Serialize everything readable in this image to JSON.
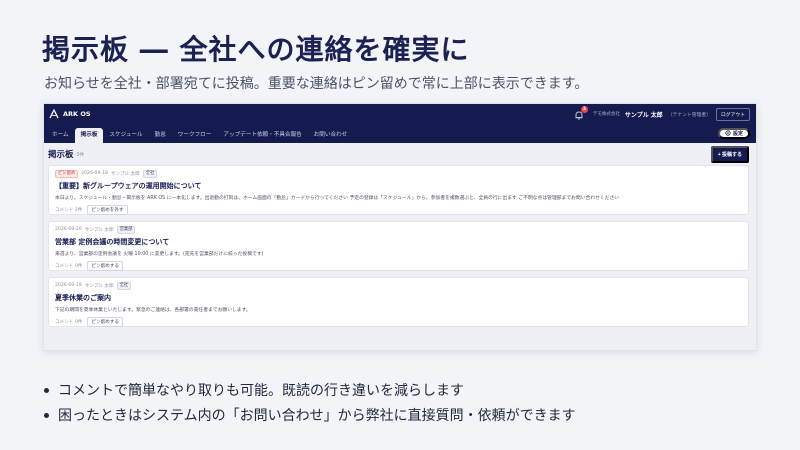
{
  "slide": {
    "title": "掲示板 ― 全社への連絡を確実に",
    "subtitle": "お知らせを全社・部署宛てに投稿。重要な連絡はピン留めで常に上部に表示できます。",
    "bullets": [
      "コメントで簡単なやり取りも可能。既読の行き違いを減らします",
      "困ったときはシステム内の「お問い合わせ」から弊社に直接質問・依頼ができます"
    ]
  },
  "app": {
    "logo_text": "ARK OS",
    "notification_count": "3",
    "company": "デモ株式会社",
    "user_name": "サンプル 太郎",
    "user_role": "（テナント管理者）",
    "logout_label": "ログアウト",
    "nav_tabs": [
      {
        "label": "ホーム",
        "active": false
      },
      {
        "label": "掲示板",
        "active": true
      },
      {
        "label": "スケジュール",
        "active": false
      },
      {
        "label": "勤怠",
        "active": false
      },
      {
        "label": "ワークフロー",
        "active": false
      },
      {
        "label": "アップデート依頼・不具合報告",
        "active": false
      },
      {
        "label": "お問い合わせ",
        "active": false
      }
    ],
    "settings_label": "設定",
    "board": {
      "title": "掲示板",
      "count": "3件",
      "post_button_label": "+ 投稿する"
    },
    "posts": [
      {
        "pin_label": "ピン留め",
        "date": "2026-09-18",
        "author": "サンプル 太郎",
        "audience": "全社",
        "title": "【重要】新グループウェアの運用開始について",
        "body": "本日より、スケジュール・勤怠・掲示板を ARK OS に一本化します。出退勤の打刻は、ホーム画面の「勤怠」カードから行ってください 予定の登録は「スケジュール」から。参加者を複数選ぶと、全員の行に出ます ご不明な点は管理部までお問い合わせください",
        "comments": "コメント 2件",
        "pin_action": "ピン留めを外す"
      },
      {
        "pin_label": "",
        "date": "2026-09-20",
        "author": "サンプル 太郎",
        "audience": "営業部",
        "title": "営業部 定例会議の時間変更について",
        "body": "来週より、営業部の定例会議を 火曜 10:00 に変更します。(宛先を営業部だけに絞った投稿です)",
        "comments": "コメント 0件",
        "pin_action": "ピン留めする"
      },
      {
        "pin_label": "",
        "date": "2026-09-19",
        "author": "サンプル 太郎",
        "audience": "全社",
        "title": "夏季休業のご案内",
        "body": "下記の期間を夏季休業といたします。緊急のご連絡は、各部署の責任者までお願いします。",
        "comments": "コメント 0件",
        "pin_action": "ピン留めする"
      }
    ]
  },
  "colors": {
    "navy": "#161b4f",
    "pin_red": "#d23b3b",
    "background": "#f3f4f8"
  },
  "icons": [
    "logo-mark-icon",
    "bell-icon",
    "gear-icon",
    "bullet-dot-icon"
  ]
}
